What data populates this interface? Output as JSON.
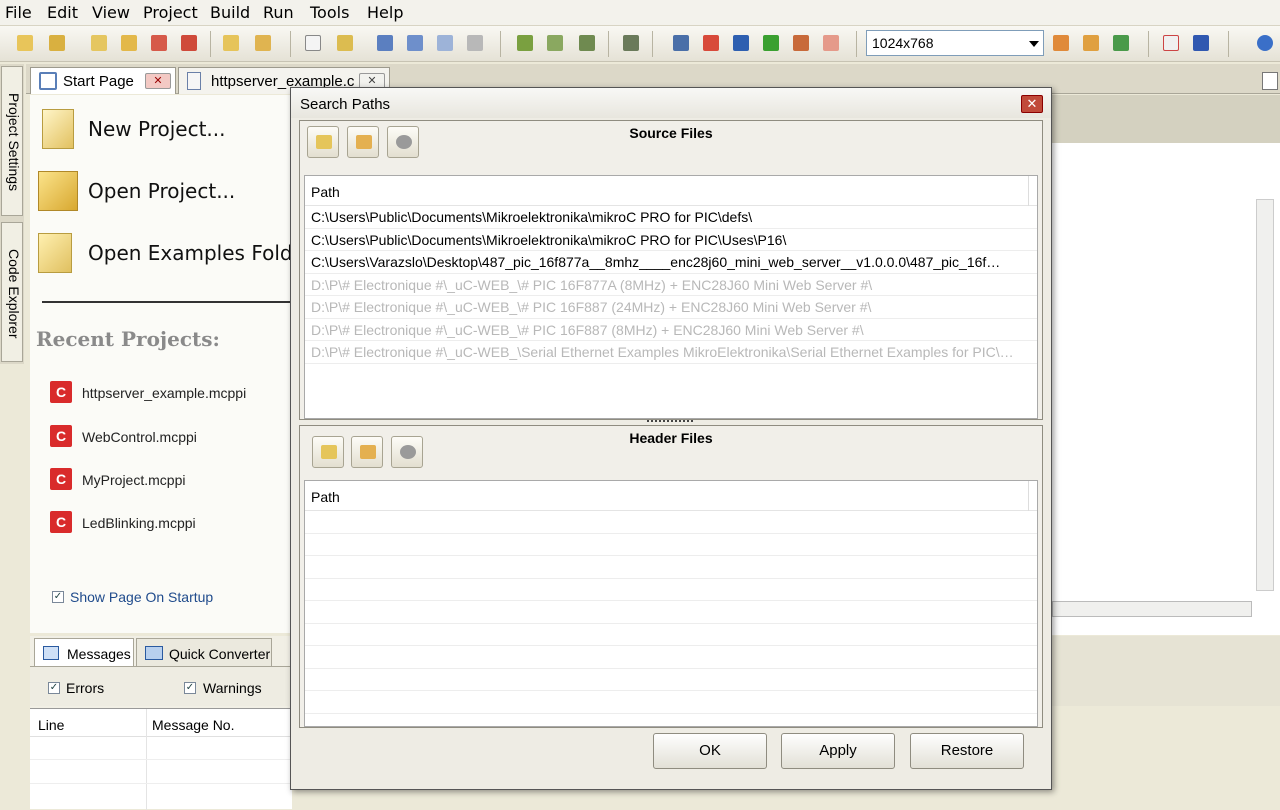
{
  "menu": [
    "File",
    "Edit",
    "View",
    "Project",
    "Build",
    "Run",
    "Tools",
    "Help"
  ],
  "toolbar": {
    "resolution": "1024x768"
  },
  "left_tabs": {
    "project_settings": "Project Settings",
    "code_explorer": "Code Explorer"
  },
  "doc_tabs": [
    {
      "label": "Start Page"
    },
    {
      "label": "httpserver_example.c"
    }
  ],
  "start_page": {
    "new_project": "New Project...",
    "open_project": "Open Project...",
    "open_examples": "Open Examples Folder",
    "recent_heading": "Recent Projects:",
    "recent": [
      "httpserver_example.mcppi",
      "WebControl.mcppi",
      "MyProject.mcppi",
      "LedBlinking.mcppi"
    ],
    "show_on_startup": "Show Page On Startup"
  },
  "bottom": {
    "tabs": [
      "Messages",
      "Quick Converter"
    ],
    "errors": "Errors",
    "warnings": "Warnings",
    "columns": [
      "Line",
      "Message No."
    ]
  },
  "dialog": {
    "title": "Search Paths",
    "close": "✕",
    "source": {
      "title": "Source Files",
      "column": "Path",
      "paths": [
        "C:\\Users\\Public\\Documents\\Mikroelektronika\\mikroC PRO for PIC\\defs\\",
        "C:\\Users\\Public\\Documents\\Mikroelektronika\\mikroC PRO for PIC\\Uses\\P16\\",
        "C:\\Users\\Varazslo\\Desktop\\487_pic_16f877a__8mhz____enc28j60_mini_web_server__v1.0.0.0\\487_pic_16f…",
        "D:\\P\\# Electronique #\\_uC-WEB_\\# PIC 16F877A (8MHz) + ENC28J60 Mini Web Server #\\",
        "D:\\P\\# Electronique #\\_uC-WEB_\\# PIC 16F887 (24MHz) + ENC28J60 Mini Web Server #\\",
        "D:\\P\\# Electronique #\\_uC-WEB_\\# PIC 16F887 (8MHz) + ENC28J60 Mini Web Server #\\",
        "D:\\P\\# Electronique #\\_uC-WEB_\\Serial Ethernet Examples MikroElektronika\\Serial Ethernet Examples for PIC\\…"
      ]
    },
    "header": {
      "title": "Header Files",
      "column": "Path"
    },
    "buttons": {
      "ok": "OK",
      "apply": "Apply",
      "restore": "Restore"
    }
  },
  "colors": {
    "accent": "#316ac5",
    "recent_icon": "#d92b2b",
    "close": "#c14a3a"
  }
}
